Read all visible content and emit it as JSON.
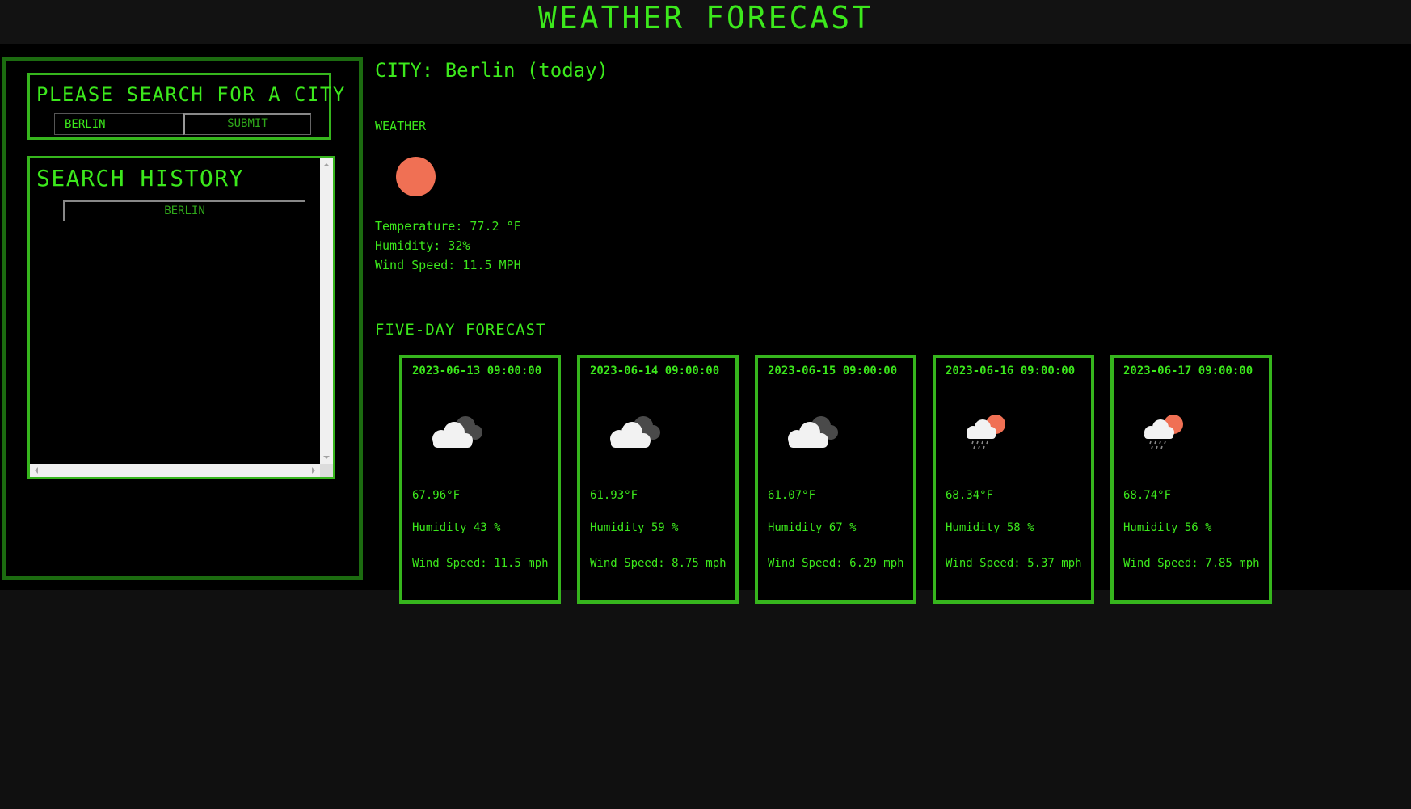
{
  "header": {
    "title": "WEATHER FORECAST"
  },
  "search": {
    "heading": "PLEASE SEARCH FOR A CITY",
    "input_value": "BERLIN",
    "submit_label": "SUBMIT"
  },
  "history": {
    "heading": "SEARCH HISTORY",
    "items": [
      {
        "label": "BERLIN"
      }
    ]
  },
  "current": {
    "city_title": "CITY: Berlin (today)",
    "weather_label": "WEATHER",
    "icon": "sun-icon",
    "temperature": "Temperature: 77.2 °F",
    "humidity": "Humidity: 32%",
    "wind": "Wind Speed: 11.5 MPH"
  },
  "forecast": {
    "title": "FIVE-DAY FORECAST",
    "days": [
      {
        "date": "2023-06-13 09:00:00",
        "icon": "cloudy-icon",
        "temp": "67.96°F",
        "humidity": "Humidity 43 %",
        "wind": "Wind Speed: 11.5 mph"
      },
      {
        "date": "2023-06-14 09:00:00",
        "icon": "cloudy-icon",
        "temp": "61.93°F",
        "humidity": "Humidity 59 %",
        "wind": "Wind Speed: 8.75 mph"
      },
      {
        "date": "2023-06-15 09:00:00",
        "icon": "cloudy-icon",
        "temp": "61.07°F",
        "humidity": "Humidity 67 %",
        "wind": "Wind Speed: 6.29 mph"
      },
      {
        "date": "2023-06-16 09:00:00",
        "icon": "sun-rain-icon",
        "temp": "68.34°F",
        "humidity": "Humidity 58 %",
        "wind": "Wind Speed: 5.37 mph"
      },
      {
        "date": "2023-06-17 09:00:00",
        "icon": "sun-rain-icon",
        "temp": "68.74°F",
        "humidity": "Humidity 56 %",
        "wind": "Wind Speed: 7.85 mph"
      }
    ]
  },
  "colors": {
    "accent_green": "#3ce81c",
    "border_green": "#36b51d",
    "sun": "#f07054",
    "cloud_white": "#f2f2f2",
    "cloud_gray": "#4a4a4a"
  }
}
